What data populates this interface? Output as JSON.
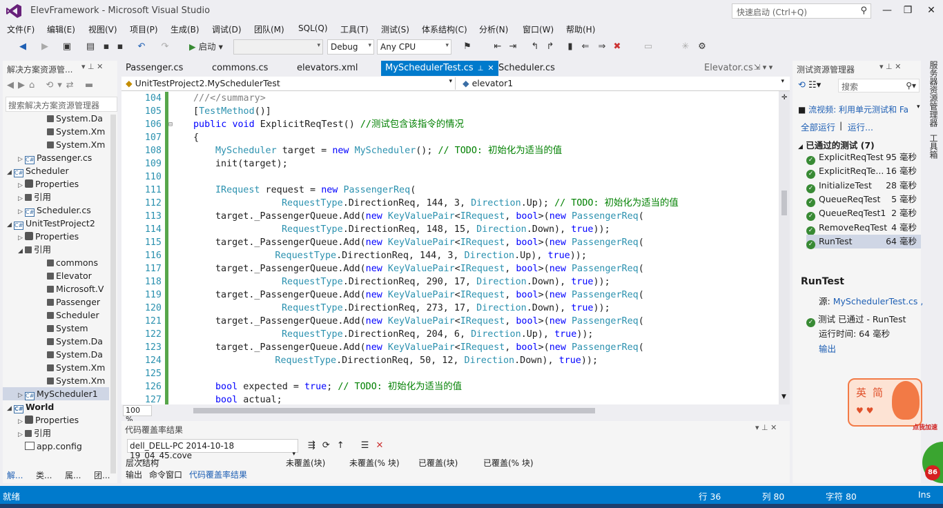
{
  "window": {
    "title": "ElevFramework - Microsoft Visual Studio",
    "quick_launch_placeholder": "快速启动 (Ctrl+Q)"
  },
  "menu": [
    "文件(F)",
    "编辑(E)",
    "视图(V)",
    "项目(P)",
    "生成(B)",
    "调试(D)",
    "团队(M)",
    "SQL(Q)",
    "工具(T)",
    "测试(S)",
    "体系结构(C)",
    "分析(N)",
    "窗口(W)",
    "帮助(H)"
  ],
  "toolbar": {
    "start_label": "启动",
    "config": "Debug",
    "platform": "Any CPU"
  },
  "solution_explorer": {
    "title": "解决方案资源管...",
    "search_placeholder": "搜索解决方案资源管理器",
    "items": [
      {
        "label": "System.Da",
        "indent": 3,
        "icon": "reference-icon"
      },
      {
        "label": "System.Xm",
        "indent": 3,
        "icon": "reference-icon"
      },
      {
        "label": "System.Xm",
        "indent": 3,
        "icon": "reference-icon"
      },
      {
        "label": "Passenger.cs",
        "indent": 1,
        "icon": "csharp-file-icon",
        "arrow": "▷"
      },
      {
        "label": "Scheduler",
        "indent": 0,
        "icon": "csharp-project-icon",
        "arrow": "◢"
      },
      {
        "label": "Properties",
        "indent": 1,
        "icon": "properties-icon",
        "arrow": "▷"
      },
      {
        "label": "引用",
        "indent": 1,
        "icon": "references-icon",
        "arrow": "▷"
      },
      {
        "label": "Scheduler.cs",
        "indent": 1,
        "icon": "csharp-file-icon",
        "arrow": "▷"
      },
      {
        "label": "UnitTestProject2",
        "indent": 0,
        "icon": "test-project-icon",
        "arrow": "◢"
      },
      {
        "label": "Properties",
        "indent": 1,
        "icon": "properties-icon",
        "arrow": "▷"
      },
      {
        "label": "引用",
        "indent": 1,
        "icon": "references-icon",
        "arrow": "◢"
      },
      {
        "label": "commons",
        "indent": 3,
        "icon": "reference-icon"
      },
      {
        "label": "Elevator",
        "indent": 3,
        "icon": "reference-icon"
      },
      {
        "label": "Microsoft.V",
        "indent": 3,
        "icon": "reference-icon"
      },
      {
        "label": "Passenger",
        "indent": 3,
        "icon": "reference-icon"
      },
      {
        "label": "Scheduler",
        "indent": 3,
        "icon": "reference-icon"
      },
      {
        "label": "System",
        "indent": 3,
        "icon": "reference-icon"
      },
      {
        "label": "System.Da",
        "indent": 3,
        "icon": "reference-icon"
      },
      {
        "label": "System.Da",
        "indent": 3,
        "icon": "reference-icon"
      },
      {
        "label": "System.Xm",
        "indent": 3,
        "icon": "reference-icon"
      },
      {
        "label": "System.Xm",
        "indent": 3,
        "icon": "reference-icon"
      },
      {
        "label": "MyScheduler1",
        "indent": 1,
        "icon": "csharp-file-icon",
        "arrow": "▷",
        "selected": true
      },
      {
        "label": "World",
        "indent": 0,
        "icon": "csharp-project-icon",
        "arrow": "◢",
        "bold": true
      },
      {
        "label": "Properties",
        "indent": 1,
        "icon": "properties-icon",
        "arrow": "▷"
      },
      {
        "label": "引用",
        "indent": 1,
        "icon": "references-icon",
        "arrow": "▷"
      },
      {
        "label": "app.config",
        "indent": 1,
        "icon": "config-file-icon"
      }
    ],
    "bottom_tabs": [
      "解...",
      "类...",
      "属...",
      "团..."
    ]
  },
  "doc_tabs": [
    "Passenger.cs",
    "commons.cs",
    "elevators.xml",
    "MySchedulerTest.cs",
    "Scheduler.cs",
    "Elevator.cs"
  ],
  "nav": {
    "class_combo": "UnitTestProject2.MySchedulerTest",
    "member_combo": "elevator1"
  },
  "code_lines": [
    {
      "n": "104",
      "html": "<span class='gr'>///&lt;/summary&gt;</span>",
      "indent": 0
    },
    {
      "n": "105",
      "html": "[<span class='ty'>TestMethod</span>()]",
      "indent": 0
    },
    {
      "n": "106",
      "html": "<span class='kw'>public</span> <span class='kw'>void</span> ExplicitReqTest() <span class='cm'>//测试包含该指令的情况</span>",
      "indent": 0
    },
    {
      "n": "107",
      "html": "{",
      "indent": 0
    },
    {
      "n": "108",
      "html": "<span class='ty'>MyScheduler</span> target = <span class='kw'>new</span> <span class='ty'>MyScheduler</span>(); <span class='cm'>// TODO: 初始化为适当的值</span>",
      "indent": 1
    },
    {
      "n": "109",
      "html": "init(target);",
      "indent": 1
    },
    {
      "n": "110",
      "html": "",
      "indent": 1
    },
    {
      "n": "111",
      "html": "<span class='ty'>IRequest</span> request = <span class='kw'>new</span> <span class='ty'>PassengerReq</span>(",
      "indent": 1
    },
    {
      "n": "112",
      "html": "<span class='ty'>RequestType</span>.DirectionReq, 144, 3, <span class='ty'>Direction</span>.Up); <span class='cm'>// TODO: 初始化为适当的值</span>",
      "indent": 4
    },
    {
      "n": "113",
      "html": "target._PassengerQueue.Add(<span class='kw'>new</span> <span class='ty'>KeyValuePair</span>&lt;<span class='ty'>IRequest</span>, <span class='kw'>bool</span>&gt;(<span class='kw'>new</span> <span class='ty'>PassengerReq</span>(",
      "indent": 1
    },
    {
      "n": "114",
      "html": "<span class='ty'>RequestType</span>.DirectionReq, 148, 15, <span class='ty'>Direction</span>.Down), <span class='kw'>true</span>));",
      "indent": 4
    },
    {
      "n": "115",
      "html": "target._PassengerQueue.Add(<span class='kw'>new</span> <span class='ty'>KeyValuePair</span>&lt;<span class='ty'>IRequest</span>, <span class='kw'>bool</span>&gt;(<span class='kw'>new</span> <span class='ty'>PassengerReq</span>(",
      "indent": 1
    },
    {
      "n": "116",
      "html": "<span class='ty'>RequestType</span>.DirectionReq, 144, 3, <span class='ty'>Direction</span>.Up), <span class='kw'>true</span>));",
      "indent": 3.7
    },
    {
      "n": "117",
      "html": "target._PassengerQueue.Add(<span class='kw'>new</span> <span class='ty'>KeyValuePair</span>&lt;<span class='ty'>IRequest</span>, <span class='kw'>bool</span>&gt;(<span class='kw'>new</span> <span class='ty'>PassengerReq</span>(",
      "indent": 1
    },
    {
      "n": "118",
      "html": "<span class='ty'>RequestType</span>.DirectionReq, 290, 17, <span class='ty'>Direction</span>.Down), <span class='kw'>true</span>));",
      "indent": 4
    },
    {
      "n": "119",
      "html": "target._PassengerQueue.Add(<span class='kw'>new</span> <span class='ty'>KeyValuePair</span>&lt;<span class='ty'>IRequest</span>, <span class='kw'>bool</span>&gt;(<span class='kw'>new</span> <span class='ty'>PassengerReq</span>(",
      "indent": 1
    },
    {
      "n": "120",
      "html": "<span class='ty'>RequestType</span>.DirectionReq, 273, 17, <span class='ty'>Direction</span>.Down), <span class='kw'>true</span>));",
      "indent": 4
    },
    {
      "n": "121",
      "html": "target._PassengerQueue.Add(<span class='kw'>new</span> <span class='ty'>KeyValuePair</span>&lt;<span class='ty'>IRequest</span>, <span class='kw'>bool</span>&gt;(<span class='kw'>new</span> <span class='ty'>PassengerReq</span>(",
      "indent": 1
    },
    {
      "n": "122",
      "html": "<span class='ty'>RequestType</span>.DirectionReq, 204, 6, <span class='ty'>Direction</span>.Up), <span class='kw'>true</span>));",
      "indent": 4
    },
    {
      "n": "123",
      "html": "target._PassengerQueue.Add(<span class='kw'>new</span> <span class='ty'>KeyValuePair</span>&lt;<span class='ty'>IRequest</span>, <span class='kw'>bool</span>&gt;(<span class='kw'>new</span> <span class='ty'>PassengerReq</span>(",
      "indent": 1
    },
    {
      "n": "124",
      "html": "<span class='ty'>RequestType</span>.DirectionReq, 50, 12, <span class='ty'>Direction</span>.Down), <span class='kw'>true</span>));",
      "indent": 3.7
    },
    {
      "n": "125",
      "html": "",
      "indent": 1
    },
    {
      "n": "126",
      "html": "<span class='kw'>bool</span> expected = <span class='kw'>true</span>; <span class='cm'>// TODO: 初始化为适当的值</span>",
      "indent": 1
    },
    {
      "n": "127",
      "html": "<span class='kw'>bool</span> actual;",
      "indent": 1
    }
  ],
  "zoom": "100 %",
  "coverage": {
    "title": "代码覆盖率结果",
    "file_combo": "dell_DELL-PC 2014-10-18 19_04_45.cove",
    "columns": [
      "层次结构",
      "未覆盖(块)",
      "未覆盖(% 块)",
      "已覆盖(块)",
      "已覆盖(% 块)"
    ],
    "bottom_tabs": [
      "输出",
      "命令窗口",
      "代码覆盖率结果"
    ]
  },
  "test_explorer": {
    "title": "测试资源管理器",
    "search_placeholder": "搜索",
    "playlist": "流视频: 利用单元测试和 Fa",
    "run_all": "全部运行",
    "run": "运行...",
    "group_header": "已通过的测试 (7)",
    "tests": [
      {
        "name": "ExplicitReqTest",
        "time": "95 毫秒"
      },
      {
        "name": "ExplicitReqTe...",
        "time": "16 毫秒"
      },
      {
        "name": "InitializeTest",
        "time": "28 毫秒"
      },
      {
        "name": "QueueReqTest",
        "time": "5 毫秒"
      },
      {
        "name": "QueueReqTest1",
        "time": "2 毫秒"
      },
      {
        "name": "RemoveReqTest",
        "time": "4 毫秒"
      },
      {
        "name": "RunTest",
        "time": "64 毫秒"
      }
    ],
    "detail": {
      "name": "RunTest",
      "source_label": "源:",
      "source_link": "MySchedulerTest.cs ,",
      "result": "测试 已通过 - RunTest",
      "elapsed": "运行时间: 64 毫秒",
      "output_link": "输出"
    }
  },
  "side_strip": [
    "服务器资源管理器",
    "工具箱"
  ],
  "ime_widget": {
    "text1": "英",
    "text2": "简",
    "badge": "点我加速",
    "counter": "86"
  },
  "status": {
    "left": "就绪",
    "row": "行 36",
    "col": "列 80",
    "char": "字符 80",
    "mode": "Ins"
  },
  "colors": {
    "accent": "#007acc",
    "passed": "#388a34"
  }
}
